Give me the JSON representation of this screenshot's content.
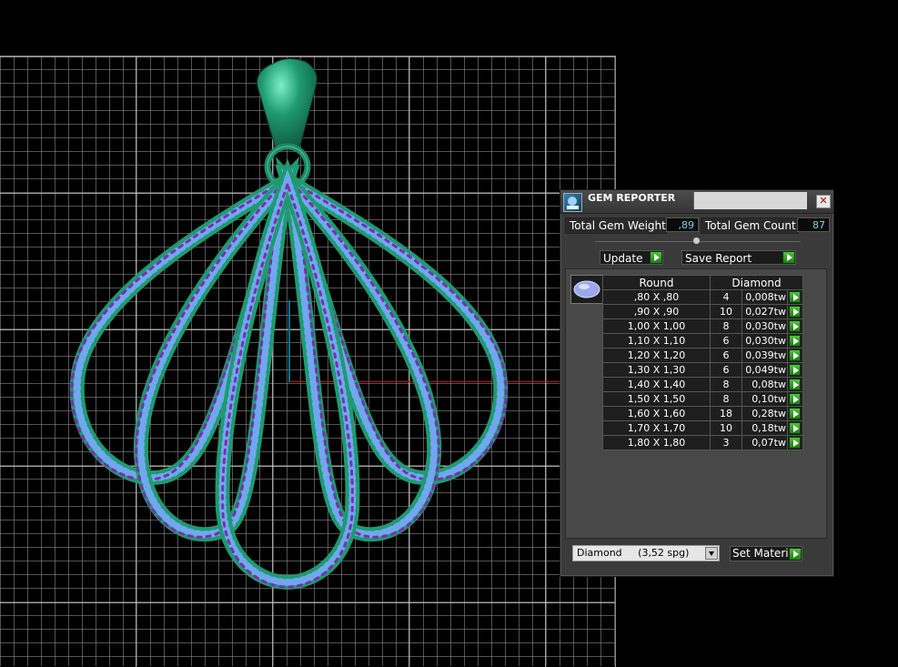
{
  "viewport": {
    "grid_color": "#8c8c8c",
    "axis_x_color": "#c01010",
    "axis_y_color": "#0a7090"
  },
  "pendant": {
    "metal_color": "#1f9a70",
    "gem_color_primary": "#7fb2f0",
    "gem_color_secondary": "#7a2fb0"
  },
  "gem_reporter": {
    "title": "GEM REPORTER",
    "close_icon": "close-icon",
    "total_gem_weight_label": "Total Gem Weight",
    "total_gem_weight_value": ",89",
    "total_gem_count_label": "Total Gem Count",
    "total_gem_count_value": "87",
    "update_label": "Update",
    "save_report_label": "Save Report",
    "table": {
      "headers": [
        "Round",
        "Diamond"
      ],
      "rows": [
        {
          "size": ",80 X ,80",
          "count": "4",
          "weight": "0,008tw"
        },
        {
          "size": ",90 X ,90",
          "count": "10",
          "weight": "0,027tw"
        },
        {
          "size": "1,00 X 1,00",
          "count": "8",
          "weight": "0,030tw"
        },
        {
          "size": "1,10 X 1,10",
          "count": "6",
          "weight": "0,030tw"
        },
        {
          "size": "1,20 X 1,20",
          "count": "6",
          "weight": "0,039tw"
        },
        {
          "size": "1,30 X 1,30",
          "count": "6",
          "weight": "0,049tw"
        },
        {
          "size": "1,40 X 1,40",
          "count": "8",
          "weight": "0,08tw"
        },
        {
          "size": "1,50 X 1,50",
          "count": "8",
          "weight": "0,10tw"
        },
        {
          "size": "1,60 X 1,60",
          "count": "18",
          "weight": "0,28tw"
        },
        {
          "size": "1,70 X 1,70",
          "count": "10",
          "weight": "0,18tw"
        },
        {
          "size": "1,80 X 1,80",
          "count": "3",
          "weight": "0,07tw"
        }
      ]
    },
    "material_select_value": "Diamond     (3,52 spg)",
    "set_material_label": "Set Material",
    "accent_go_color": "#3fb02a"
  }
}
